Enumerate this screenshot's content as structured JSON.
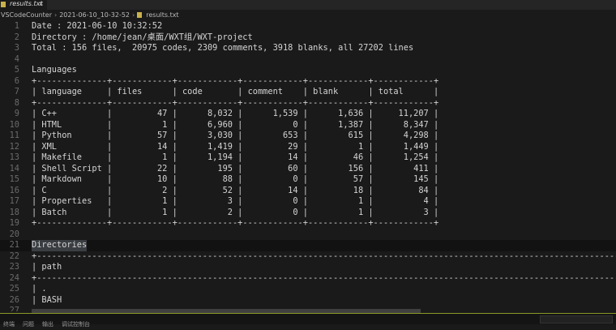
{
  "tab": {
    "label": "results.txt",
    "close": "×"
  },
  "breadcrumb": [
    "VSCodeCounter",
    "2021-06-10_10-32-52",
    "results.txt"
  ],
  "editor": {
    "current_line": 21,
    "lines": [
      "Date : 2021-06-10 10:32:52",
      "Directory : /home/jean/桌面/WXT组/WXT-project",
      "Total : 156 files,  20975 codes, 2309 comments, 3918 blanks, all 27202 lines",
      "",
      "Languages",
      "+--------------+------------+------------+------------+------------+------------+",
      "| language     | files      | code       | comment    | blank      | total      |",
      "+--------------+------------+------------+------------+------------+------------+",
      "| C++          |         47 |      8,032 |      1,539 |      1,636 |     11,207 |",
      "| HTML         |          1 |      6,960 |          0 |      1,387 |      8,347 |",
      "| Python       |         57 |      3,030 |        653 |        615 |      4,298 |",
      "| XML          |         14 |      1,419 |         29 |          1 |      1,449 |",
      "| Makefile     |          1 |      1,194 |         14 |         46 |      1,254 |",
      "| Shell Script |         22 |        195 |         60 |        156 |        411 |",
      "| Markdown     |         10 |         88 |          0 |         57 |        145 |",
      "| C            |          2 |         52 |         14 |         18 |         84 |",
      "| Properties   |          1 |          3 |          0 |          1 |          4 |",
      "| Batch        |          1 |          2 |          0 |          1 |          3 |",
      "+--------------+------------+------------+------------+------------+------------+",
      "",
      "Directories",
      "+------------------------------------------------------------------------------------------------------------------------",
      "| path",
      "+------------------------------------------------------------------------------------------------------------------------",
      "| .",
      "| BASH",
      ""
    ]
  },
  "panel": {
    "tabs": [
      "终端",
      "问题",
      "输出",
      "调试控制台"
    ]
  }
}
